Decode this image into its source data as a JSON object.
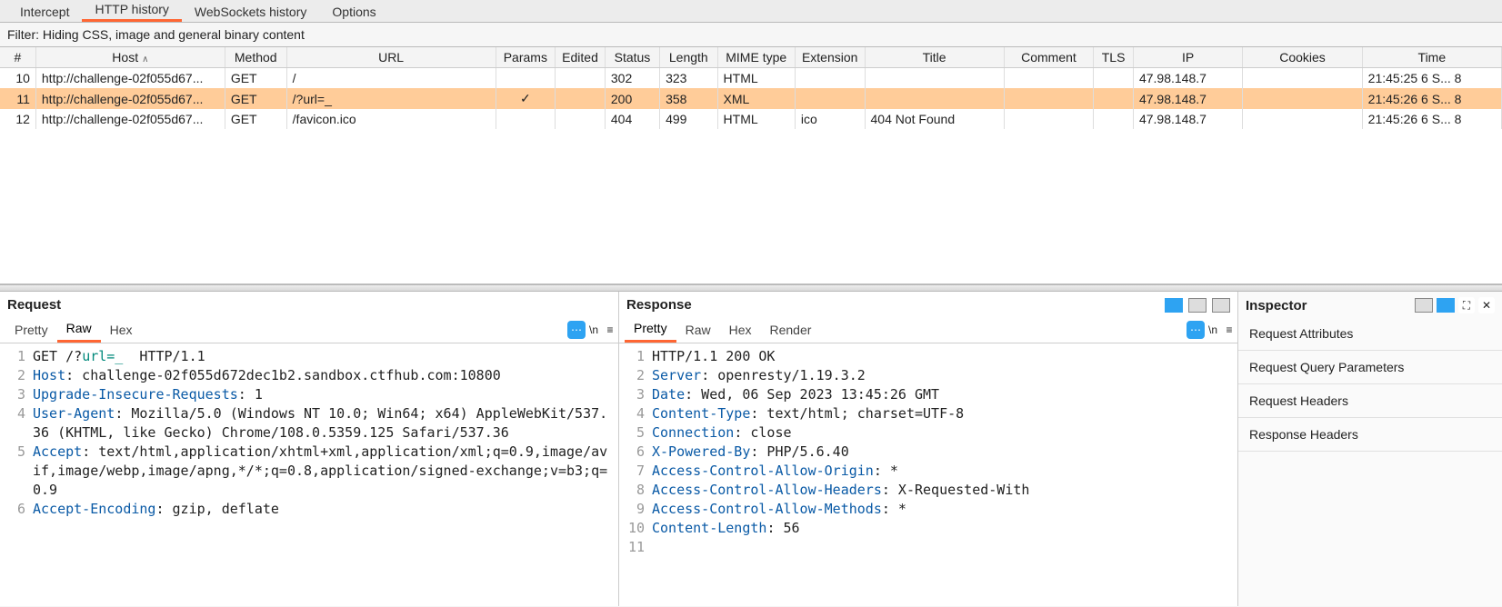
{
  "topTabs": {
    "intercept": "Intercept",
    "httpHistory": "HTTP history",
    "wsHistory": "WebSockets history",
    "options": "Options"
  },
  "filterText": "Filter: Hiding CSS, image and general binary content",
  "columns": {
    "num": "#",
    "host": "Host",
    "method": "Method",
    "url": "URL",
    "params": "Params",
    "edited": "Edited",
    "status": "Status",
    "length": "Length",
    "mime": "MIME type",
    "ext": "Extension",
    "title": "Title",
    "comment": "Comment",
    "tls": "TLS",
    "ip": "IP",
    "cookies": "Cookies",
    "time": "Time"
  },
  "rows": [
    {
      "num": "10",
      "host": "http://challenge-02f055d67...",
      "method": "GET",
      "url": "/",
      "params": "",
      "edited": "",
      "status": "302",
      "length": "323",
      "mime": "HTML",
      "ext": "",
      "title": "",
      "comment": "",
      "tls": "",
      "ip": "47.98.148.7",
      "cookies": "",
      "time": "21:45:25 6 S...   8",
      "selected": false
    },
    {
      "num": "11",
      "host": "http://challenge-02f055d67...",
      "method": "GET",
      "url": "/?url=_",
      "params": "✓",
      "edited": "",
      "status": "200",
      "length": "358",
      "mime": "XML",
      "ext": "",
      "title": "",
      "comment": "",
      "tls": "",
      "ip": "47.98.148.7",
      "cookies": "",
      "time": "21:45:26 6 S...   8",
      "selected": true
    },
    {
      "num": "12",
      "host": "http://challenge-02f055d67...",
      "method": "GET",
      "url": "/favicon.ico",
      "params": "",
      "edited": "",
      "status": "404",
      "length": "499",
      "mime": "HTML",
      "ext": "ico",
      "title": "404 Not Found",
      "comment": "",
      "tls": "",
      "ip": "47.98.148.7",
      "cookies": "",
      "time": "21:45:26 6 S...   8",
      "selected": false
    }
  ],
  "request": {
    "title": "Request",
    "tabs": {
      "pretty": "Pretty",
      "raw": "Raw",
      "hex": "Hex"
    },
    "activeTab": "raw",
    "lines": [
      {
        "n": "1",
        "segs": [
          {
            "t": "GET /?",
            "c": "vl"
          },
          {
            "t": "url=_",
            "c": "hl"
          },
          {
            "t": "  HTTP/1.1",
            "c": "vl"
          }
        ]
      },
      {
        "n": "2",
        "segs": [
          {
            "t": "Host",
            "c": "kw"
          },
          {
            "t": ": challenge-02f055d672dec1b2.sandbox.ctfhub.com:10800",
            "c": "vl"
          }
        ]
      },
      {
        "n": "3",
        "segs": [
          {
            "t": "Upgrade-Insecure-Requests",
            "c": "kw"
          },
          {
            "t": ": 1",
            "c": "vl"
          }
        ]
      },
      {
        "n": "4",
        "segs": [
          {
            "t": "User-Agent",
            "c": "kw"
          },
          {
            "t": ": Mozilla/5.0 (Windows NT 10.0; Win64; x64) AppleWebKit/537.36 (KHTML, like Gecko) Chrome/108.0.5359.125 Safari/537.36",
            "c": "vl"
          }
        ]
      },
      {
        "n": "5",
        "segs": [
          {
            "t": "Accept",
            "c": "kw"
          },
          {
            "t": ": text/html,application/xhtml+xml,application/xml;q=0.9,image/avif,image/webp,image/apng,*/*;q=0.8,application/signed-exchange;v=b3;q=0.9",
            "c": "vl"
          }
        ]
      },
      {
        "n": "6",
        "segs": [
          {
            "t": "Accept-Encoding",
            "c": "kw"
          },
          {
            "t": ": gzip, deflate",
            "c": "vl"
          }
        ]
      }
    ]
  },
  "response": {
    "title": "Response",
    "tabs": {
      "pretty": "Pretty",
      "raw": "Raw",
      "hex": "Hex",
      "render": "Render"
    },
    "activeTab": "pretty",
    "lines": [
      {
        "n": "1",
        "segs": [
          {
            "t": "HTTP/1.1 200 OK",
            "c": "vl"
          }
        ]
      },
      {
        "n": "2",
        "segs": [
          {
            "t": "Server",
            "c": "kw"
          },
          {
            "t": ": openresty/1.19.3.2",
            "c": "vl"
          }
        ]
      },
      {
        "n": "3",
        "segs": [
          {
            "t": "Date",
            "c": "kw"
          },
          {
            "t": ": Wed, 06 Sep 2023 13:45:26 GMT",
            "c": "vl"
          }
        ]
      },
      {
        "n": "4",
        "segs": [
          {
            "t": "Content-Type",
            "c": "kw"
          },
          {
            "t": ": text/html; charset=UTF-8",
            "c": "vl"
          }
        ]
      },
      {
        "n": "5",
        "segs": [
          {
            "t": "Connection",
            "c": "kw"
          },
          {
            "t": ": close",
            "c": "vl"
          }
        ]
      },
      {
        "n": "6",
        "segs": [
          {
            "t": "X-Powered-By",
            "c": "kw"
          },
          {
            "t": ": PHP/5.6.40",
            "c": "vl"
          }
        ]
      },
      {
        "n": "7",
        "segs": [
          {
            "t": "Access-Control-Allow-Origin",
            "c": "kw"
          },
          {
            "t": ": *",
            "c": "vl"
          }
        ]
      },
      {
        "n": "8",
        "segs": [
          {
            "t": "Access-Control-Allow-Headers",
            "c": "kw"
          },
          {
            "t": ": X-Requested-With",
            "c": "vl"
          }
        ]
      },
      {
        "n": "9",
        "segs": [
          {
            "t": "Access-Control-Allow-Methods",
            "c": "kw"
          },
          {
            "t": ": *",
            "c": "vl"
          }
        ]
      },
      {
        "n": "10",
        "segs": [
          {
            "t": "Content-Length",
            "c": "kw"
          },
          {
            "t": ": 56",
            "c": "vl"
          }
        ]
      },
      {
        "n": "11",
        "segs": [
          {
            "t": "",
            "c": "vl"
          }
        ]
      }
    ]
  },
  "inspector": {
    "title": "Inspector",
    "sections": {
      "attrs": "Request Attributes",
      "query": "Request Query Parameters",
      "reqHeaders": "Request Headers",
      "respHeaders": "Response Headers"
    }
  },
  "icons": {
    "newline": "\\n",
    "menu": "≡",
    "layout1": "▯▯",
    "layout2": "≡",
    "layout3": "▭",
    "gear": "⚙",
    "expand": "⛶"
  }
}
